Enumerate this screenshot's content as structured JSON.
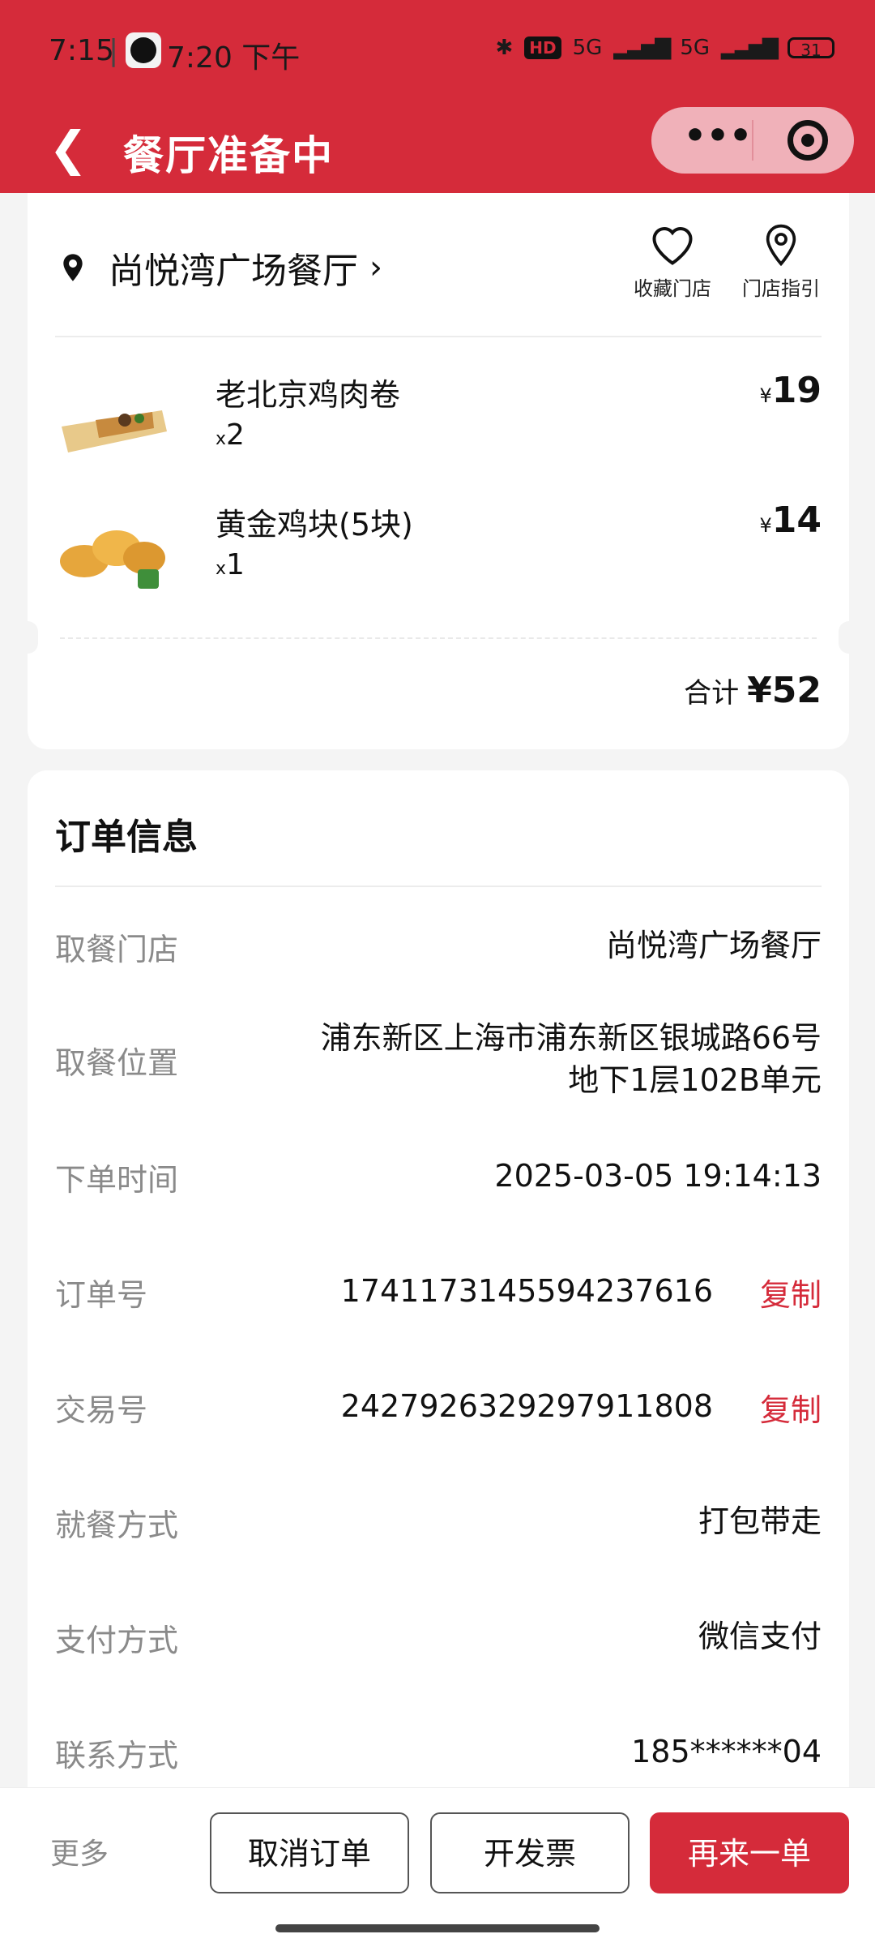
{
  "status_bar": {
    "time": "7:15",
    "separator": "|",
    "secondary_time": "7:20 下午",
    "hd_badge": "HD",
    "network_1": "5G",
    "network_2": "5G",
    "battery": "31"
  },
  "nav": {
    "title": "餐厅准备中",
    "back_icon": "chevron-left-icon",
    "more_icon": "more-dots-icon",
    "close_icon": "target-icon"
  },
  "store": {
    "name": "尚悦湾广场餐厅",
    "chevron": "›",
    "favorite_label": "收藏门店",
    "guide_label": "门店指引"
  },
  "items": [
    {
      "name": "老北京鸡肉卷",
      "qty_prefix": "x",
      "qty": "2",
      "currency": "¥",
      "price": "19"
    },
    {
      "name": "黄金鸡块(5块)",
      "qty_prefix": "x",
      "qty": "1",
      "currency": "¥",
      "price": "14"
    }
  ],
  "total": {
    "label": "合计",
    "amount": "¥52"
  },
  "order_info": {
    "title": "订单信息",
    "rows": [
      {
        "label": "取餐门店",
        "value": "尚悦湾广场餐厅"
      },
      {
        "label": "取餐位置",
        "value_line1": "浦东新区上海市浦东新区银城路66号",
        "value_line2": "地下1层102B单元"
      },
      {
        "label": "下单时间",
        "value": "2025-03-05 19:14:13"
      },
      {
        "label": "订单号",
        "value": "1741173145594237616",
        "action": "复制"
      },
      {
        "label": "交易号",
        "value": "2427926329297911808",
        "action": "复制"
      },
      {
        "label": "就餐方式",
        "value": "打包带走"
      },
      {
        "label": "支付方式",
        "value": "微信支付"
      },
      {
        "label": "联系方式",
        "value": "185******04"
      }
    ]
  },
  "bottom": {
    "more": "更多",
    "cancel": "取消订单",
    "invoice": "开发票",
    "reorder": "再来一单"
  },
  "colors": {
    "brand_red": "#d52b3a",
    "label_gray": "#8a8a8a"
  }
}
